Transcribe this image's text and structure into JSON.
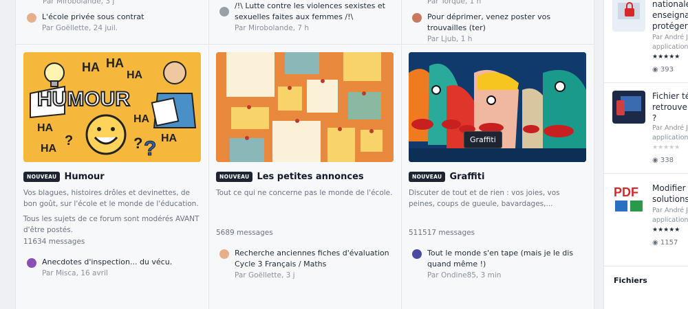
{
  "row1": {
    "col1": {
      "prev_meta": "Par Mirobolande, 3 j",
      "title": "L'école privée sous contrat",
      "meta": "Par Goëllette, 24 juil."
    },
    "col2": {
      "title": "/!\\ Lutte contre les violences sexistes et sexuelles faites aux femmes /!\\",
      "meta": "Par Mirobolande, 7 h"
    },
    "col3": {
      "prev_meta": "Par Torque, 1 h",
      "title": "Pour déprimer, venez poster vos trouvailles (ter)",
      "meta": "Par Ljub, 1 h"
    }
  },
  "cards": [
    {
      "badge": "NOUVEAU",
      "title": "Humour",
      "desc": "Vos blagues, histoires drôles et devinettes, de bon goût, sur l'école et le monde de l'éducation.",
      "desc2": "Tous les sujets de ce forum sont modérés AVANT d'être postés.",
      "count": "11634 messages",
      "last_title": "Anecdotes d'inspection... du vécu.",
      "last_meta": "Par Misca, 16 avril",
      "image_text": "HUMOUR",
      "image_has": [
        "HA",
        "HA",
        "HA",
        "HA",
        "HA",
        "HA",
        "HA",
        "?",
        "?",
        "?"
      ]
    },
    {
      "badge": "NOUVEAU",
      "title": "Les petites annonces",
      "desc": "Tout ce qui ne concerne pas le monde de l'école.",
      "count": "5689 messages",
      "last_title": "Recherche anciennes fiches d'évaluation Cycle 3 Français / Maths",
      "last_meta": "Par Goëllette, 3 j"
    },
    {
      "badge": "NOUVEAU",
      "title": "Graffiti",
      "desc": "Discuter de tout et de rien : vos joies, vos peines, coups de gueule, bavardages,...",
      "count": "511517 messages",
      "last_title": "Tout le monde s'en tape (mais je le dis quand même !)",
      "last_meta": "Par Ondine85, 3 min",
      "tooltip": "Graffiti"
    }
  ],
  "sidebar": {
    "files": [
      {
        "title_lines": [
          "nationale",
          "enseignan",
          "protéger"
        ],
        "meta_lines": [
          "Par André Jo",
          "applications"
        ],
        "rating": 5,
        "views": "393",
        "thumb_icon": "lock-icon"
      },
      {
        "title_lines": [
          "Fichier tél",
          "retrouver",
          "?"
        ],
        "meta_lines": [
          "Par André Jo",
          "applications"
        ],
        "rating": 0,
        "views": "338",
        "thumb_icon": "computer-icon"
      },
      {
        "title_lines": [
          "Modifier u",
          "solutions"
        ],
        "meta_lines": [
          "Par André Jo",
          "applications"
        ],
        "rating": 5,
        "views": "1157",
        "thumb_icon": "pdf-icon",
        "thumb_text": "PDF"
      }
    ],
    "section_title": "Fichiers"
  },
  "colors": {
    "badge_bg": "#1f2433",
    "humour_bg": "#f6b83c",
    "annonces_bg": "#e8893e",
    "graffiti_bg": "#103a6b",
    "star": "#1f2937"
  }
}
